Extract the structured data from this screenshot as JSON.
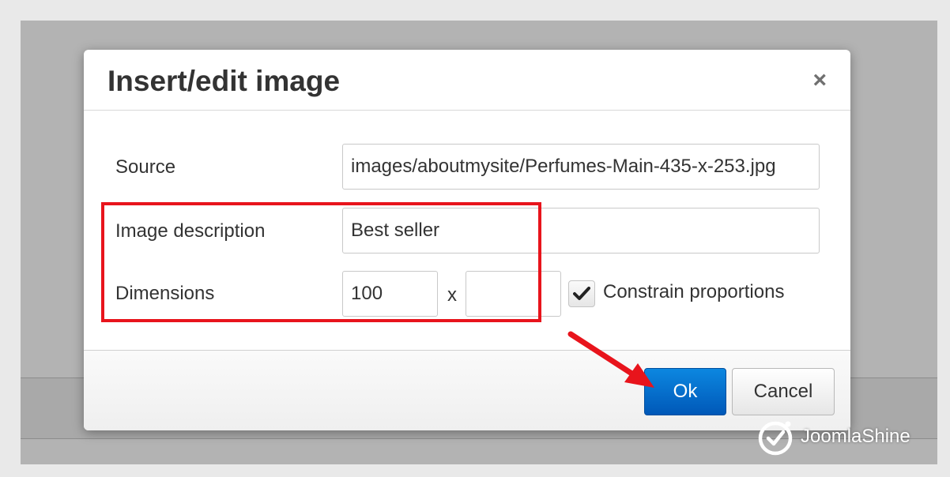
{
  "dialog": {
    "title": "Insert/edit image",
    "close_label": "×"
  },
  "form": {
    "source_label": "Source",
    "source_value": "images/aboutmysite/Perfumes-Main-435-x-253.jpg",
    "description_label": "Image description",
    "description_value": "Best seller",
    "dimensions_label": "Dimensions",
    "width_value": "100",
    "height_value": "",
    "times_symbol": "x",
    "constrain_label": "Constrain proportions",
    "constrain_checked": true
  },
  "footer": {
    "ok_label": "Ok",
    "cancel_label": "Cancel"
  },
  "watermark": {
    "brand_text": "JoomlaShine"
  },
  "colors": {
    "highlight": "#e8141c",
    "ok_button": "#0a6ecf"
  }
}
